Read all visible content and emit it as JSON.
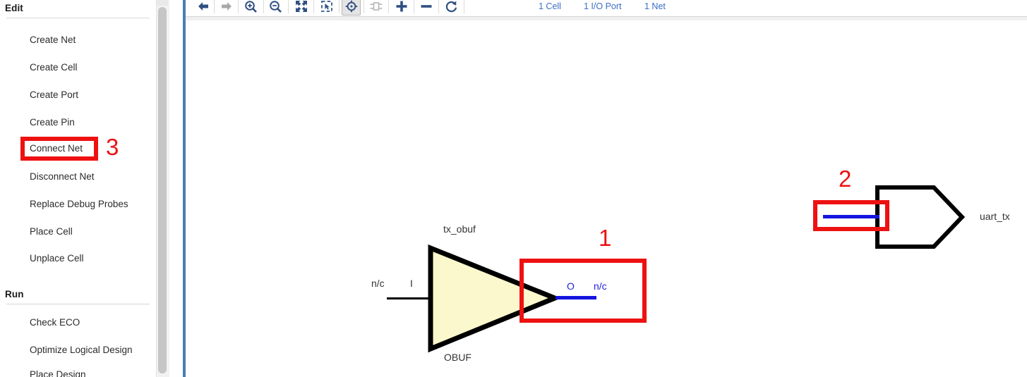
{
  "left_panel": {
    "sections": [
      {
        "title": "Edit",
        "items": [
          {
            "label": "Create Net"
          },
          {
            "label": "Create Cell"
          },
          {
            "label": "Create Port"
          },
          {
            "label": "Create Pin"
          },
          {
            "label": "Connect Net"
          },
          {
            "label": "Disconnect Net"
          },
          {
            "label": "Replace Debug Probes"
          },
          {
            "label": "Place Cell"
          },
          {
            "label": "Unplace Cell"
          }
        ]
      },
      {
        "title": "Run",
        "items": [
          {
            "label": "Check ECO"
          },
          {
            "label": "Optimize Logical Design"
          },
          {
            "label": "Place Design"
          }
        ]
      }
    ]
  },
  "toolbar": {
    "buttons": [
      {
        "name": "back-arrow-icon",
        "label": "Back"
      },
      {
        "name": "forward-arrow-icon",
        "label": "Forward"
      },
      {
        "name": "zoom-in-icon",
        "label": "Zoom In"
      },
      {
        "name": "zoom-out-icon",
        "label": "Zoom Out"
      },
      {
        "name": "zoom-fit-icon",
        "label": "Zoom Fit"
      },
      {
        "name": "zoom-area-icon",
        "label": "Zoom Area"
      },
      {
        "name": "autofit-selection-icon",
        "label": "Autofit Selection"
      },
      {
        "name": "expand-cell-icon",
        "label": "Expand Cell"
      },
      {
        "name": "add-icon",
        "label": "Add Selected"
      },
      {
        "name": "remove-icon",
        "label": "Remove Selected"
      },
      {
        "name": "reload-icon",
        "label": "Reload"
      }
    ],
    "counts": [
      {
        "text": "1 Cell"
      },
      {
        "text": "1 I/O Port"
      },
      {
        "text": "1 Net"
      }
    ],
    "accent_color": "#3b6ec6"
  },
  "schematic": {
    "cell": {
      "instance_name": "tx_obuf",
      "ref_name": "OBUF",
      "input_pin": "I",
      "input_connection": "n/c",
      "output_pin": "O",
      "output_connection": "n/c",
      "fill_color": "#fbf8cd",
      "outline_color": "#000000"
    },
    "port": {
      "name": "uart_tx",
      "outline_color": "#000000"
    },
    "net_color": "#1414e0"
  },
  "annotations": {
    "color": "#ee1111",
    "markers": [
      {
        "number": "1",
        "target": "obuf-output-pin"
      },
      {
        "number": "2",
        "target": "uart-tx-port-pin"
      },
      {
        "number": "3",
        "target": "connect-net-menu-item"
      }
    ]
  }
}
